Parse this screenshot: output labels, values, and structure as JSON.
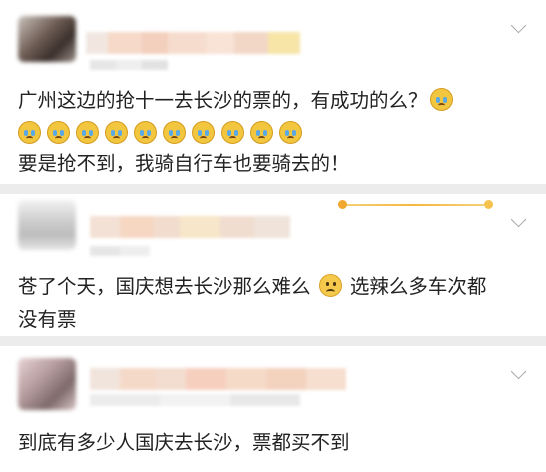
{
  "comments": [
    {
      "lines": [
        "广州这边的抢十一去长沙的票的，有成功的么？"
      ],
      "line2": "要是抢不到，我骑自行车也要骑去的！",
      "crying_emoji_count": 11
    },
    {
      "line1_a": "苍了个天，国庆想去长沙那么难么",
      "line1_b": "选辣么多车次都",
      "line2": "没有票"
    },
    {
      "line1": "到底有多少人国庆去长沙，票都买不到"
    }
  ],
  "icons": {
    "expand": "chevron-down-icon",
    "crying": "crying-face-emoji",
    "sad": "sad-face-emoji"
  },
  "colors": {
    "text": "#222222",
    "separator": "#ececec",
    "chevron": "#a8a8a8"
  }
}
